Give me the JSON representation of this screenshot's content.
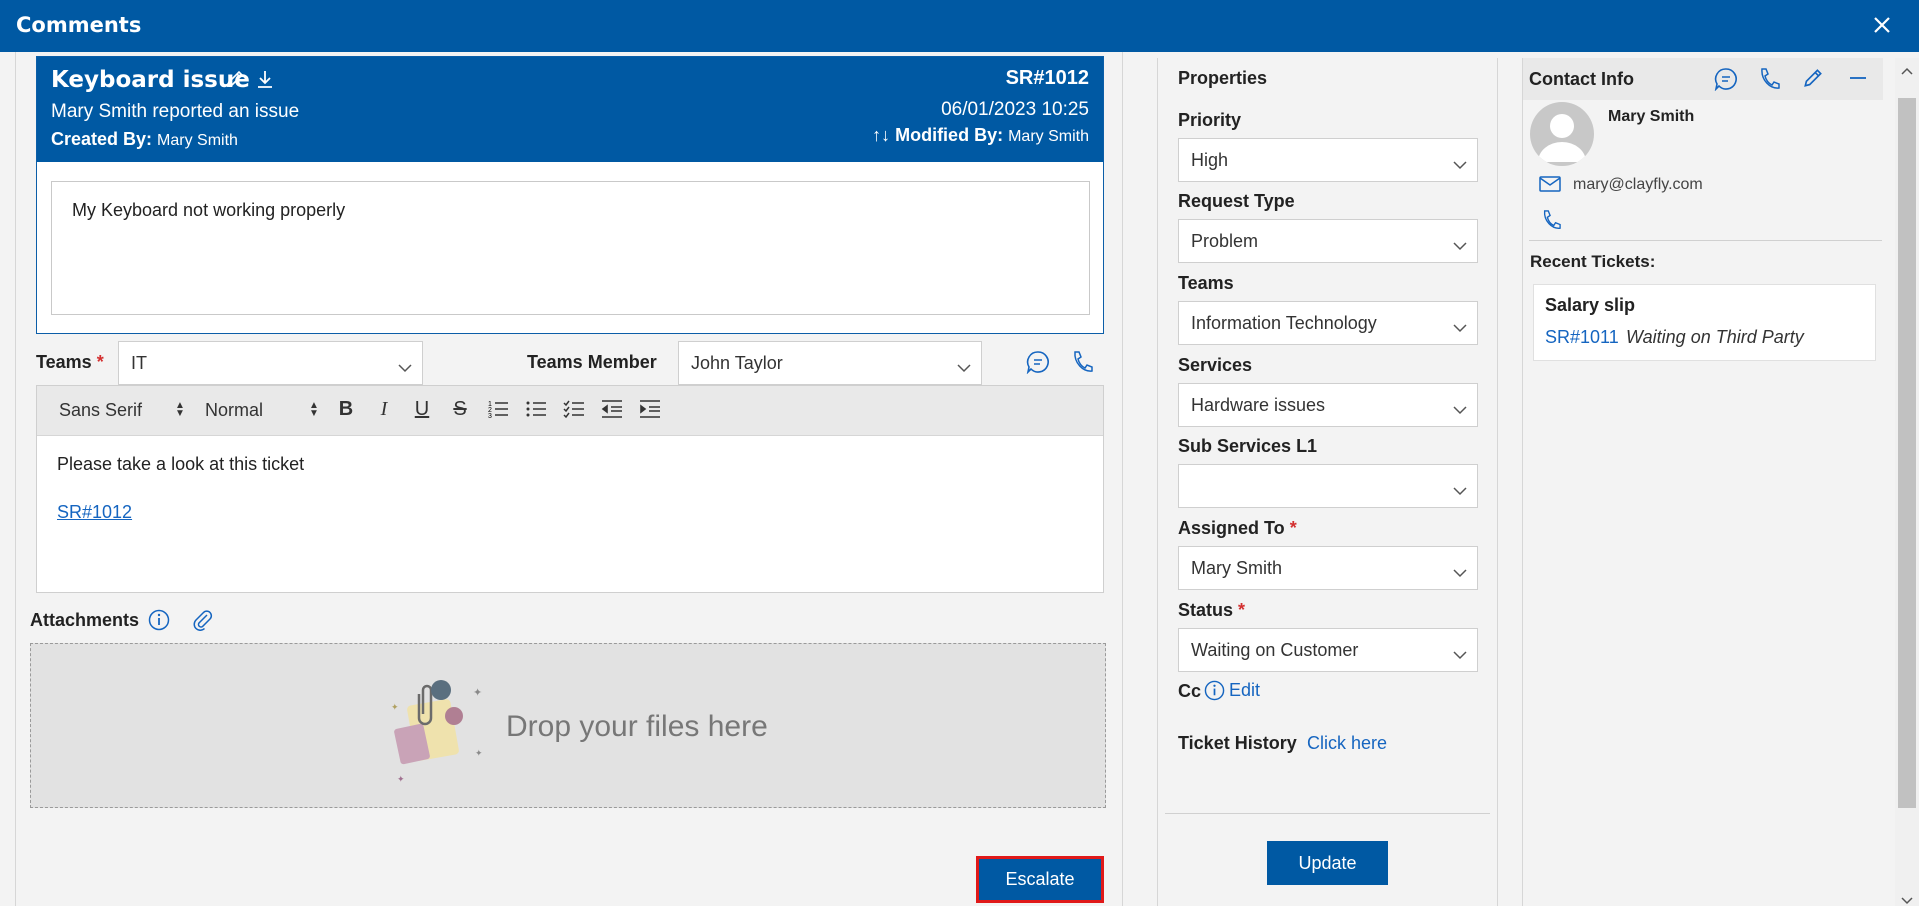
{
  "window": {
    "title": "Comments"
  },
  "ticket": {
    "title": "Keyboard issue",
    "reported": "Mary Smith reported an issue",
    "created_label": "Created By:",
    "created_by": "Mary Smith",
    "id": "SR#1012",
    "datetime": "06/01/2023 10:25",
    "modified_arrows": "↑↓",
    "modified_label": "Modified By:",
    "modified_by": "Mary Smith",
    "description": "My Keyboard not working properly"
  },
  "comment_form": {
    "teams_label": "Teams",
    "teams_value": "IT",
    "member_label": "Teams Member",
    "member_value": "John Taylor",
    "toolbar": {
      "font": "Sans Serif",
      "size": "Normal"
    },
    "body_text": "Please take a look at this ticket",
    "body_link": "SR#1012",
    "attachments_label": "Attachments",
    "drop_text": "Drop your files here",
    "escalate_label": "Escalate"
  },
  "properties": {
    "title": "Properties",
    "priority_label": "Priority",
    "priority_value": "High",
    "request_type_label": "Request Type",
    "request_type_value": "Problem",
    "teams_label": "Teams",
    "teams_value": "Information Technology",
    "services_label": "Services",
    "services_value": "Hardware issues",
    "sub_services_label": "Sub Services L1",
    "sub_services_value": "",
    "assigned_label": "Assigned To",
    "assigned_value": "Mary Smith",
    "status_label": "Status",
    "status_value": "Waiting on Customer",
    "cc_label": "Cc",
    "cc_edit": "Edit",
    "history_label": "Ticket History",
    "history_link": "Click here",
    "update_label": "Update"
  },
  "contact": {
    "title": "Contact Info",
    "name": "Mary Smith",
    "email": "mary@clayfly.com",
    "recent_label": "Recent Tickets:",
    "recent": {
      "title": "Salary slip",
      "id": "SR#1011",
      "status": "Waiting on Third Party"
    }
  },
  "colors": {
    "brand": "#0059a3",
    "link": "#1565c0",
    "required": "#d32f2f",
    "highlight": "#e01919"
  }
}
